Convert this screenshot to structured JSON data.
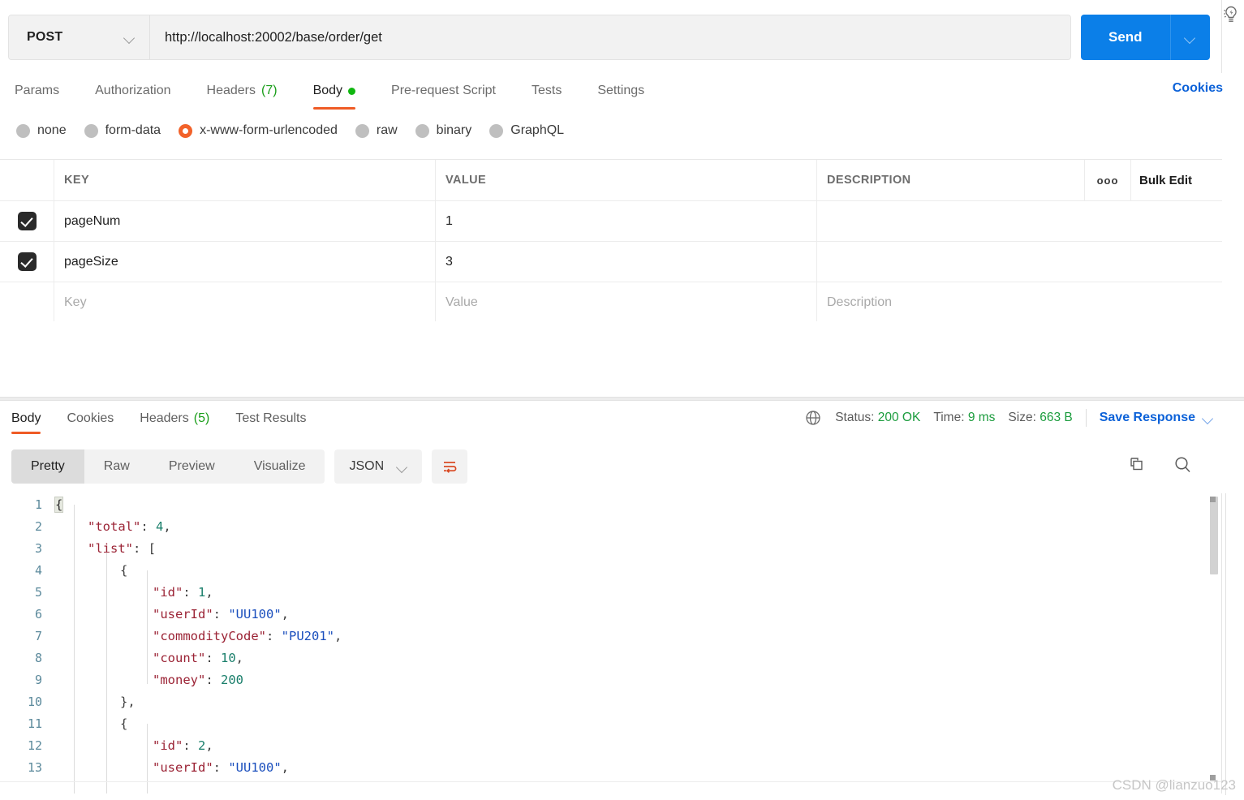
{
  "request": {
    "method": "POST",
    "url": "http://localhost:20002/base/order/get",
    "send_label": "Send",
    "tabs": [
      {
        "label": "Params",
        "active": false,
        "badge": "",
        "dot": false
      },
      {
        "label": "Authorization",
        "active": false,
        "badge": "",
        "dot": false
      },
      {
        "label": "Headers",
        "active": false,
        "badge": "(7)",
        "dot": false
      },
      {
        "label": "Body",
        "active": true,
        "badge": "",
        "dot": true
      },
      {
        "label": "Pre-request Script",
        "active": false,
        "badge": "",
        "dot": false
      },
      {
        "label": "Tests",
        "active": false,
        "badge": "",
        "dot": false
      },
      {
        "label": "Settings",
        "active": false,
        "badge": "",
        "dot": false
      }
    ],
    "cookies_label": "Cookies",
    "body_types": [
      {
        "label": "none",
        "selected": false
      },
      {
        "label": "form-data",
        "selected": false
      },
      {
        "label": "x-www-form-urlencoded",
        "selected": true
      },
      {
        "label": "raw",
        "selected": false
      },
      {
        "label": "binary",
        "selected": false
      },
      {
        "label": "GraphQL",
        "selected": false
      }
    ]
  },
  "table": {
    "headers": {
      "key": "KEY",
      "value": "VALUE",
      "description": "DESCRIPTION"
    },
    "options_icon": "ooo",
    "bulk_edit_label": "Bulk Edit",
    "rows": [
      {
        "checked": true,
        "key": "pageNum",
        "value": "1",
        "description": ""
      },
      {
        "checked": true,
        "key": "pageSize",
        "value": "3",
        "description": ""
      }
    ],
    "placeholder_row": {
      "key": "Key",
      "value": "Value",
      "description": "Description"
    }
  },
  "response": {
    "tabs": [
      {
        "label": "Body",
        "active": true,
        "badge": ""
      },
      {
        "label": "Cookies",
        "active": false,
        "badge": ""
      },
      {
        "label": "Headers",
        "active": false,
        "badge": "(5)"
      },
      {
        "label": "Test Results",
        "active": false,
        "badge": ""
      }
    ],
    "status": {
      "status_label": "Status:",
      "status_value": "200 OK",
      "time_label": "Time:",
      "time_value": "9 ms",
      "size_label": "Size:",
      "size_value": "663 B"
    },
    "save_response_label": "Save Response",
    "view_modes": [
      {
        "label": "Pretty",
        "active": true
      },
      {
        "label": "Raw",
        "active": false
      },
      {
        "label": "Preview",
        "active": false
      },
      {
        "label": "Visualize",
        "active": false
      }
    ],
    "format_selected": "JSON",
    "code_lines": [
      {
        "n": "1",
        "indent": 0,
        "tokens": [
          {
            "t": "{",
            "c": "brace-hl"
          }
        ]
      },
      {
        "n": "2",
        "indent": 1,
        "tokens": [
          {
            "t": "\"total\"",
            "c": "k-key"
          },
          {
            "t": ": ",
            "c": "k-punc"
          },
          {
            "t": "4",
            "c": "k-num"
          },
          {
            "t": ",",
            "c": "k-punc"
          }
        ]
      },
      {
        "n": "3",
        "indent": 1,
        "tokens": [
          {
            "t": "\"list\"",
            "c": "k-key"
          },
          {
            "t": ": ",
            "c": "k-punc"
          },
          {
            "t": "[",
            "c": "k-brace"
          }
        ]
      },
      {
        "n": "4",
        "indent": 2,
        "tokens": [
          {
            "t": "{",
            "c": "k-brace"
          }
        ]
      },
      {
        "n": "5",
        "indent": 3,
        "tokens": [
          {
            "t": "\"id\"",
            "c": "k-key"
          },
          {
            "t": ": ",
            "c": "k-punc"
          },
          {
            "t": "1",
            "c": "k-num"
          },
          {
            "t": ",",
            "c": "k-punc"
          }
        ]
      },
      {
        "n": "6",
        "indent": 3,
        "tokens": [
          {
            "t": "\"userId\"",
            "c": "k-key"
          },
          {
            "t": ": ",
            "c": "k-punc"
          },
          {
            "t": "\"UU100\"",
            "c": "k-str"
          },
          {
            "t": ",",
            "c": "k-punc"
          }
        ]
      },
      {
        "n": "7",
        "indent": 3,
        "tokens": [
          {
            "t": "\"commodityCode\"",
            "c": "k-key"
          },
          {
            "t": ": ",
            "c": "k-punc"
          },
          {
            "t": "\"PU201\"",
            "c": "k-str"
          },
          {
            "t": ",",
            "c": "k-punc"
          }
        ]
      },
      {
        "n": "8",
        "indent": 3,
        "tokens": [
          {
            "t": "\"count\"",
            "c": "k-key"
          },
          {
            "t": ": ",
            "c": "k-punc"
          },
          {
            "t": "10",
            "c": "k-num"
          },
          {
            "t": ",",
            "c": "k-punc"
          }
        ]
      },
      {
        "n": "9",
        "indent": 3,
        "tokens": [
          {
            "t": "\"money\"",
            "c": "k-key"
          },
          {
            "t": ": ",
            "c": "k-punc"
          },
          {
            "t": "200",
            "c": "k-num"
          }
        ]
      },
      {
        "n": "10",
        "indent": 2,
        "tokens": [
          {
            "t": "}",
            "c": "k-brace"
          },
          {
            "t": ",",
            "c": "k-punc"
          }
        ]
      },
      {
        "n": "11",
        "indent": 2,
        "tokens": [
          {
            "t": "{",
            "c": "k-brace"
          }
        ]
      },
      {
        "n": "12",
        "indent": 3,
        "tokens": [
          {
            "t": "\"id\"",
            "c": "k-key"
          },
          {
            "t": ": ",
            "c": "k-punc"
          },
          {
            "t": "2",
            "c": "k-num"
          },
          {
            "t": ",",
            "c": "k-punc"
          }
        ]
      },
      {
        "n": "13",
        "indent": 3,
        "tokens": [
          {
            "t": "\"userId\"",
            "c": "k-key"
          },
          {
            "t": ": ",
            "c": "k-punc"
          },
          {
            "t": "\"UU100\"",
            "c": "k-str"
          },
          {
            "t": ",",
            "c": "k-punc"
          }
        ]
      }
    ]
  },
  "watermark": "CSDN @lianzuo123",
  "colors": {
    "accent_orange": "#ef5b25",
    "link_blue": "#0b61d8",
    "send_blue": "#0b7fe8",
    "status_green": "#1b9c3d",
    "json_key": "#9b2335",
    "json_string": "#1b4fbd",
    "json_number": "#1a7f6b"
  }
}
